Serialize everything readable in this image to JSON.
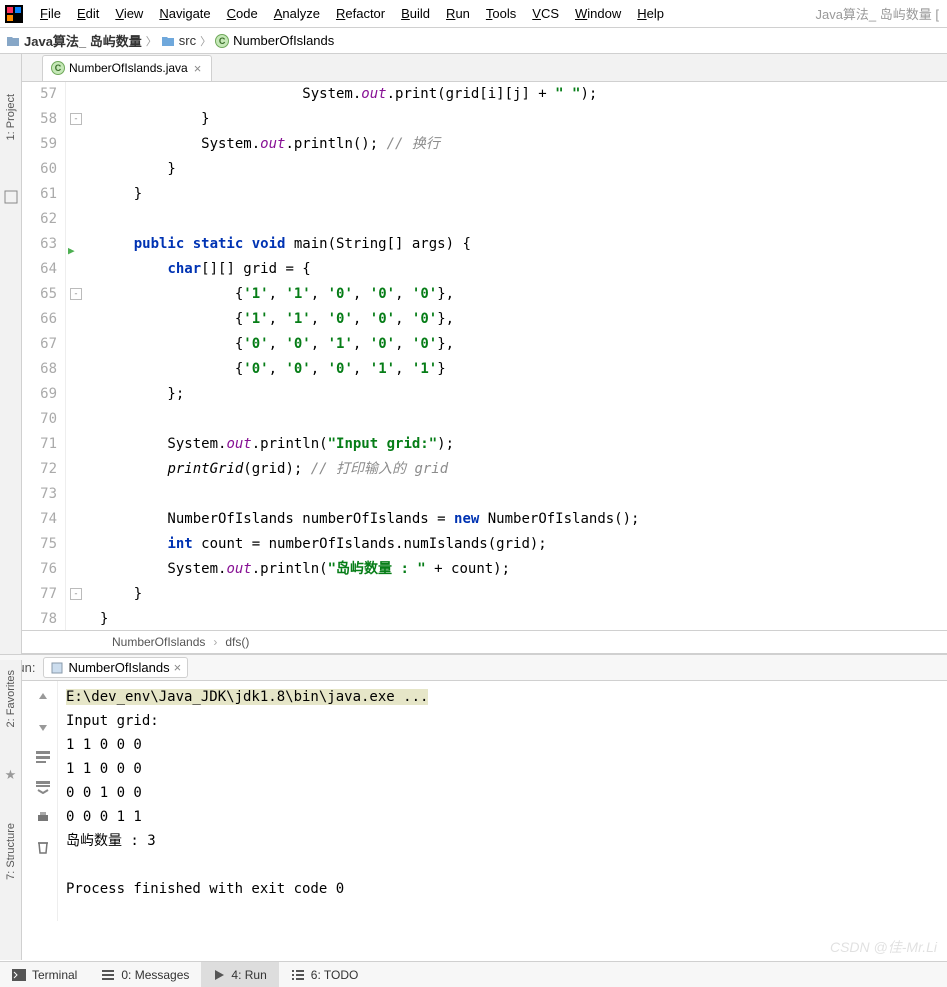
{
  "menu": {
    "items": [
      "File",
      "Edit",
      "View",
      "Navigate",
      "Code",
      "Analyze",
      "Refactor",
      "Build",
      "Run",
      "Tools",
      "VCS",
      "Window",
      "Help"
    ],
    "rightTitle": "Java算法_ 岛屿数量 ["
  },
  "breadcrumb": {
    "project": "Java算法_ 岛屿数量",
    "src": "src",
    "class": "NumberOfIslands"
  },
  "leftTools": {
    "project": "1: Project"
  },
  "leftTools2": {
    "favorites": "2: Favorites",
    "structure": "7: Structure"
  },
  "tab": {
    "file": "NumberOfIslands.java"
  },
  "code": {
    "lines": [
      {
        "n": 57,
        "html": "            System.<span class='fld'>out</span>.print(grid[i][j] + <span class='str'>\" \"</span>);",
        "partial": true
      },
      {
        "n": 58,
        "html": "        }"
      },
      {
        "n": 59,
        "html": "        System.<span class='fld'>out</span>.println(); <span class='cm'>// 换行</span>"
      },
      {
        "n": 60,
        "html": "    }"
      },
      {
        "n": 61,
        "html": "}"
      },
      {
        "n": 62,
        "html": ""
      },
      {
        "n": 63,
        "html": "<span class='kw'>public static void</span> main(String[] args) {",
        "run": true
      },
      {
        "n": 64,
        "html": "    <span class='kw'>char</span>[][] grid = {"
      },
      {
        "n": 65,
        "html": "            {<span class='str'>'1'</span>, <span class='str'>'1'</span>, <span class='str'>'0'</span>, <span class='str'>'0'</span>, <span class='str'>'0'</span>},"
      },
      {
        "n": 66,
        "html": "            {<span class='str'>'1'</span>, <span class='str'>'1'</span>, <span class='str'>'0'</span>, <span class='str'>'0'</span>, <span class='str'>'0'</span>},"
      },
      {
        "n": 67,
        "html": "            {<span class='str'>'0'</span>, <span class='str'>'0'</span>, <span class='str'>'1'</span>, <span class='str'>'0'</span>, <span class='str'>'0'</span>},"
      },
      {
        "n": 68,
        "html": "            {<span class='str'>'0'</span>, <span class='str'>'0'</span>, <span class='str'>'0'</span>, <span class='str'>'1'</span>, <span class='str'>'1'</span>}"
      },
      {
        "n": 69,
        "html": "    };"
      },
      {
        "n": 70,
        "html": ""
      },
      {
        "n": 71,
        "html": "    System.<span class='fld'>out</span>.println(<span class='str'>\"Input grid:\"</span>);"
      },
      {
        "n": 72,
        "html": "    <span class='fn'>printGrid</span>(grid); <span class='cm'>// 打印输入的 grid</span>"
      },
      {
        "n": 73,
        "html": ""
      },
      {
        "n": 74,
        "html": "    NumberOfIslands numberOfIslands = <span class='kw'>new</span> NumberOfIslands();"
      },
      {
        "n": 75,
        "html": "    <span class='kw'>int</span> count = numberOfIslands.numIslands(grid);"
      },
      {
        "n": 76,
        "html": "    System.<span class='fld'>out</span>.println(<span class='str'>\"岛屿数量 : \"</span> + count);"
      },
      {
        "n": 77,
        "html": "}"
      },
      {
        "n": 78,
        "html": "}",
        "outdent": true
      }
    ],
    "baseIndent": "    "
  },
  "crumbs": {
    "c1": "NumberOfIslands",
    "c2": "dfs()"
  },
  "run": {
    "label": "Run:",
    "config": "NumberOfIslands",
    "cmd": "E:\\dev_env\\Java_JDK\\jdk1.8\\bin\\java.exe ...",
    "out": [
      "Input grid:",
      "1 1 0 0 0",
      "1 1 0 0 0",
      "0 0 1 0 0",
      "0 0 0 1 1",
      "岛屿数量 : 3",
      "",
      "Process finished with exit code 0"
    ]
  },
  "bottom": {
    "terminal": "Terminal",
    "messages": "0: Messages",
    "run": "4: Run",
    "todo": "6: TODO"
  },
  "watermark": "CSDN @佳-Mr.Li"
}
